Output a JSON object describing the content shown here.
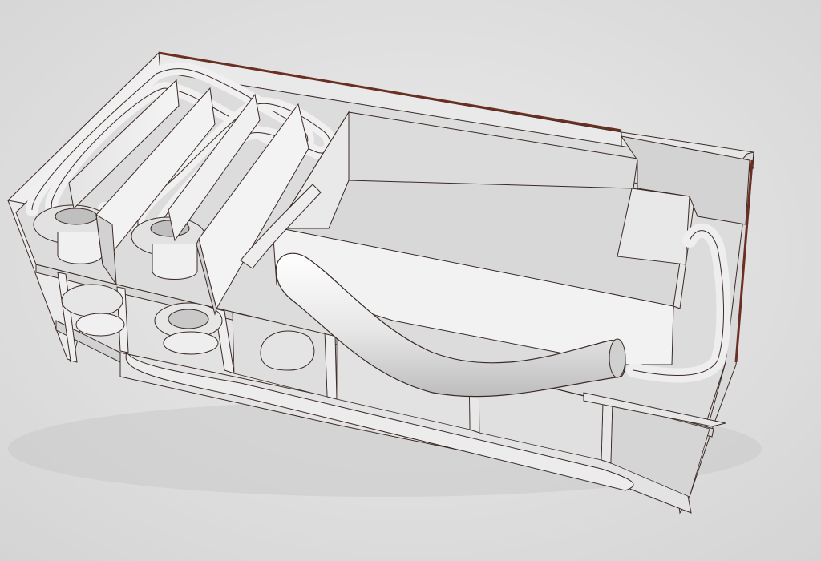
{
  "image": {
    "subject": "",
    "colors": {
      "background": "#dcdcdc",
      "background_light": "#e8e8e8",
      "wall_light": "#f2f2f2",
      "wall_mid": "#e3e3e3",
      "wall_dark": "#c9c9c9",
      "floor": "#d8d8d8",
      "outline": "#3a2a26",
      "edge_brown": "#6b2e22",
      "shadow": "#b8b8b8"
    }
  }
}
